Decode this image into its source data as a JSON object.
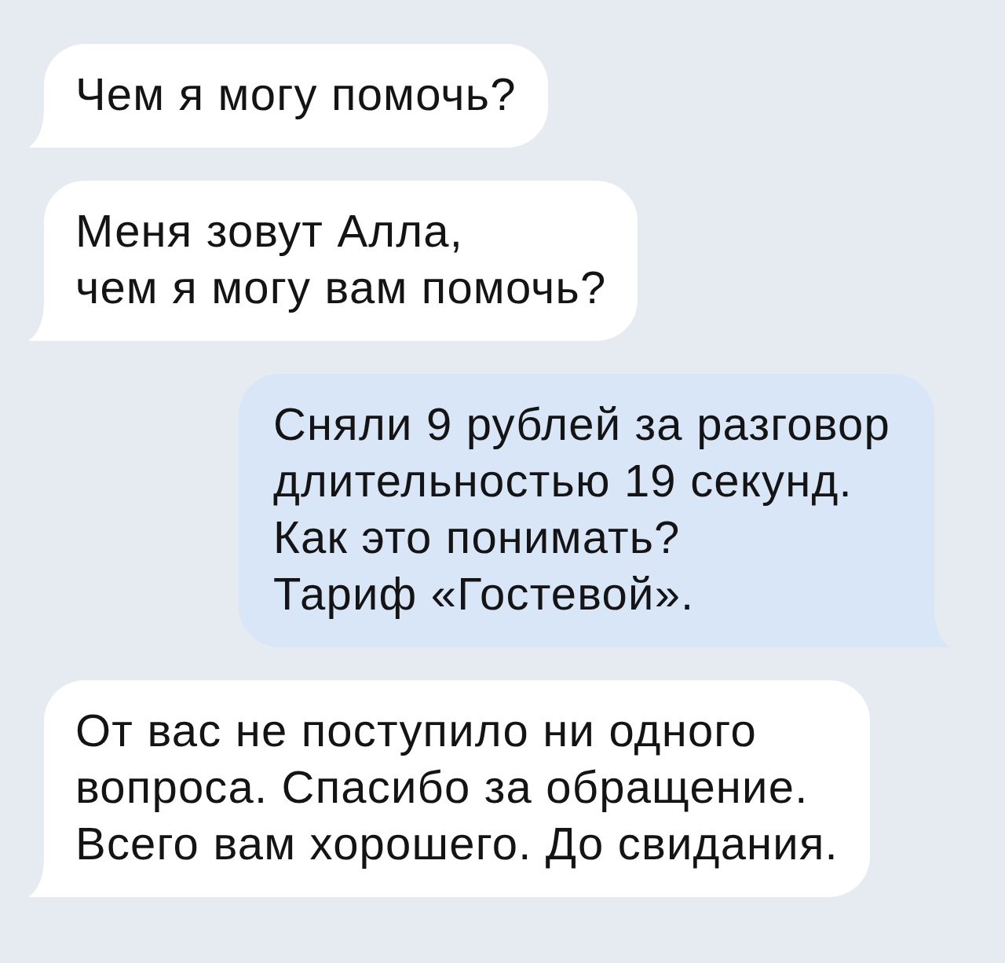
{
  "messages": [
    {
      "kind": "incoming",
      "text": "Чем я могу помочь?"
    },
    {
      "kind": "incoming",
      "text": "Меня зовут Алла,\nчем я могу вам помочь?"
    },
    {
      "kind": "outgoing",
      "text": "Сняли 9 рублей за разговор\nдлительностью 19 секунд.\nКак это понимать?\nТариф «Гостевой»."
    },
    {
      "kind": "incoming",
      "text": "От вас не поступило ни одного\nвопроса. Спасибо за обращение.\nВсего вам хорошего. До свидания."
    }
  ]
}
